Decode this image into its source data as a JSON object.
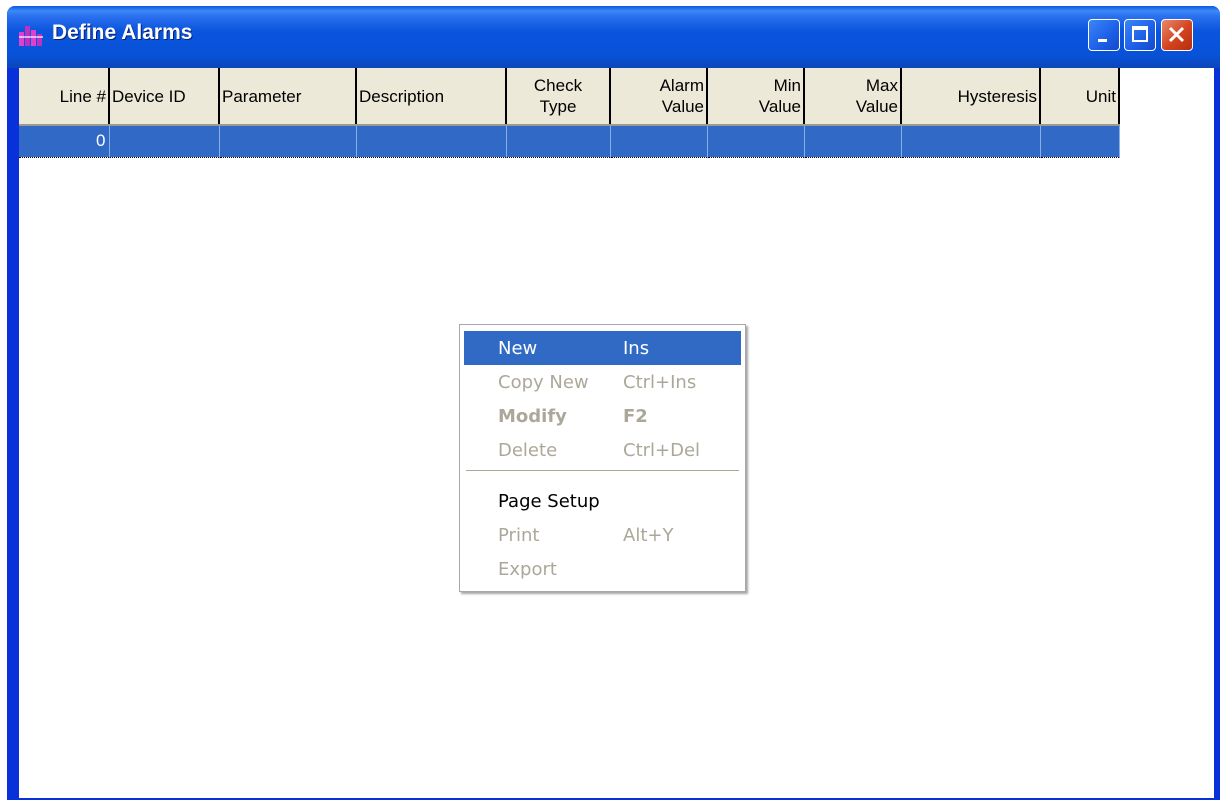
{
  "window": {
    "title": "Define Alarms",
    "controls": {
      "minimize": "minimize-icon",
      "maximize": "maximize-icon",
      "close": "close-icon"
    }
  },
  "grid": {
    "columns": [
      {
        "line1": "Line #",
        "line2": ""
      },
      {
        "line1": "Device ID",
        "line2": ""
      },
      {
        "line1": "Parameter",
        "line2": ""
      },
      {
        "line1": "Description",
        "line2": ""
      },
      {
        "line1": "Check",
        "line2": "Type"
      },
      {
        "line1": "Alarm",
        "line2": "Value"
      },
      {
        "line1": "Min",
        "line2": "Value"
      },
      {
        "line1": "Max",
        "line2": "Value"
      },
      {
        "line1": "Hysteresis",
        "line2": ""
      },
      {
        "line1": "Unit",
        "line2": ""
      }
    ],
    "rows": [
      [
        "0",
        "",
        "",
        "",
        "",
        "",
        "",
        "",
        "",
        ""
      ]
    ]
  },
  "context_menu": {
    "items": [
      {
        "label": "New",
        "shortcut": "Ins",
        "state": "highlighted"
      },
      {
        "label": "Copy New",
        "shortcut": "Ctrl+Ins",
        "state": "disabled"
      },
      {
        "label": "Modify",
        "shortcut": "F2",
        "state": "disabled-bold"
      },
      {
        "label": "Delete",
        "shortcut": "Ctrl+Del",
        "state": "disabled"
      },
      {
        "label": "Page Setup",
        "shortcut": "",
        "state": "enabled"
      },
      {
        "label": "Print",
        "shortcut": "Alt+Y",
        "state": "disabled"
      },
      {
        "label": "Export",
        "shortcut": "",
        "state": "disabled"
      }
    ]
  },
  "colors": {
    "titlebar": "#0a55de",
    "selection": "#316ac5",
    "header_bg": "#ece9d8",
    "disabled_text": "#aca899"
  }
}
